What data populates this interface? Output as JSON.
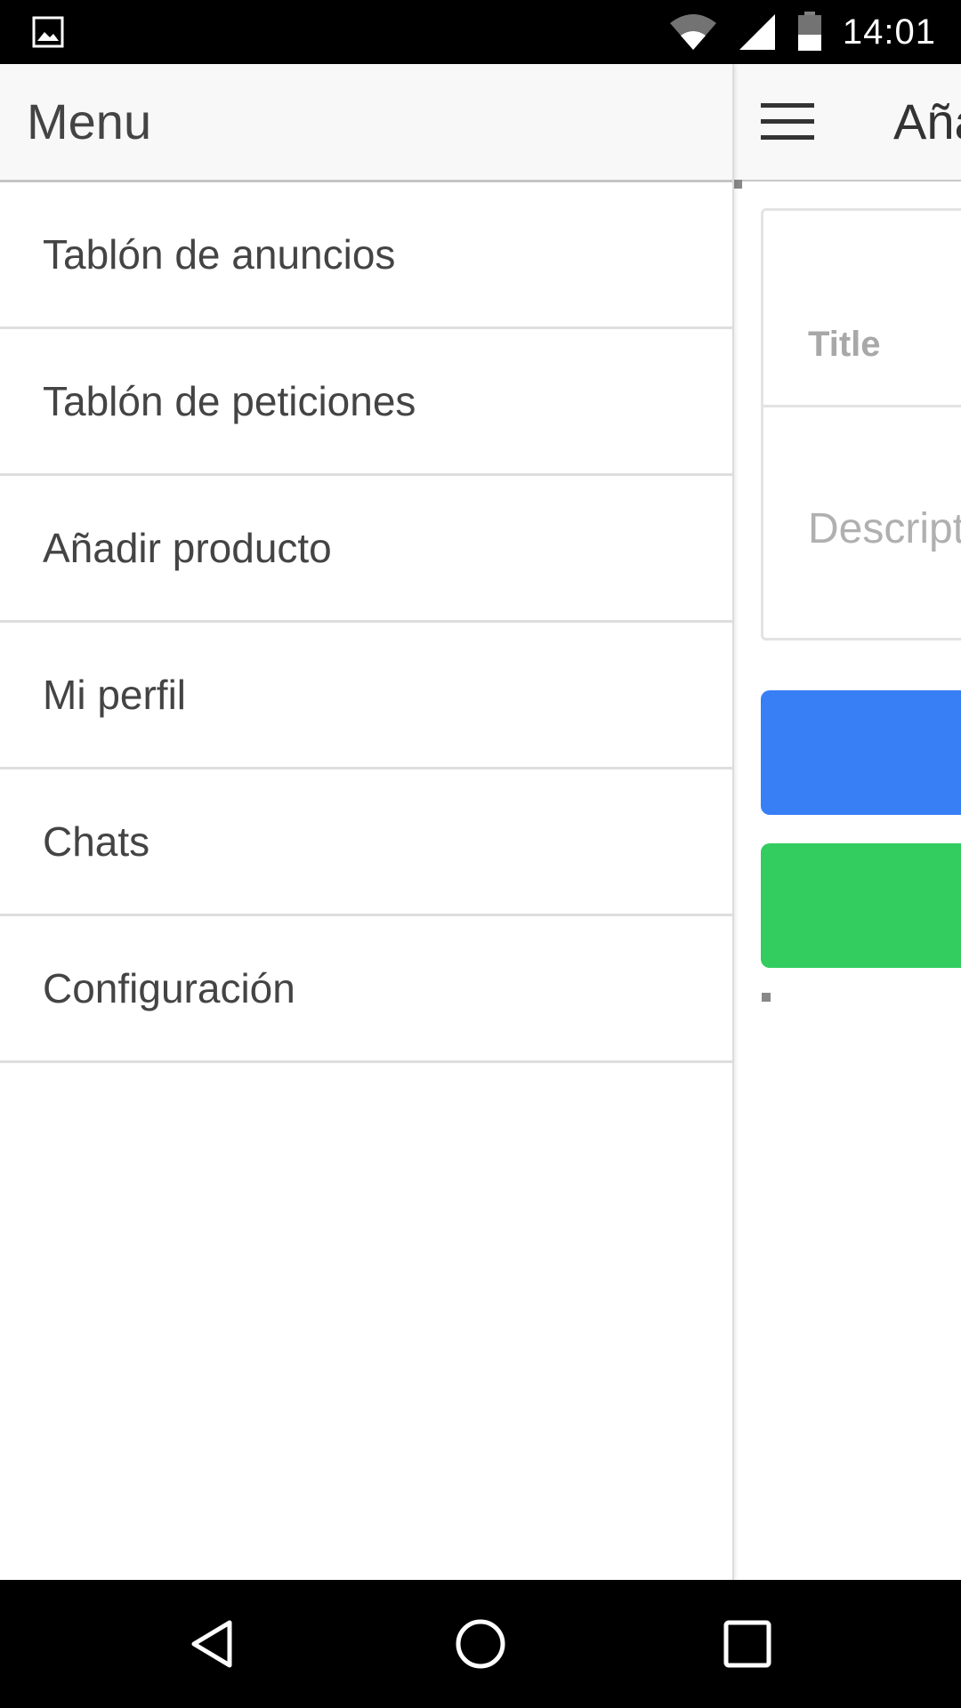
{
  "status_bar": {
    "time": "14:01",
    "icons": [
      "image-icon",
      "wifi-icon",
      "signal-icon",
      "battery-icon"
    ]
  },
  "drawer": {
    "title": "Menu",
    "items": [
      {
        "label": "Tablón de anuncios"
      },
      {
        "label": "Tablón de peticiones"
      },
      {
        "label": "Añadir producto"
      },
      {
        "label": "Mi perfil"
      },
      {
        "label": "Chats"
      },
      {
        "label": "Configuración"
      }
    ]
  },
  "main": {
    "title": "Añadir producto",
    "title_visible": "Aña",
    "form": {
      "title_label": "Title",
      "description_placeholder": "Description",
      "description_visible": "Descript"
    },
    "buttons": {
      "primary_color": "#387ef5",
      "secondary_color": "#33cd5f"
    }
  },
  "nav_bar": {
    "icons": [
      "back-icon",
      "home-icon",
      "recents-icon"
    ]
  }
}
